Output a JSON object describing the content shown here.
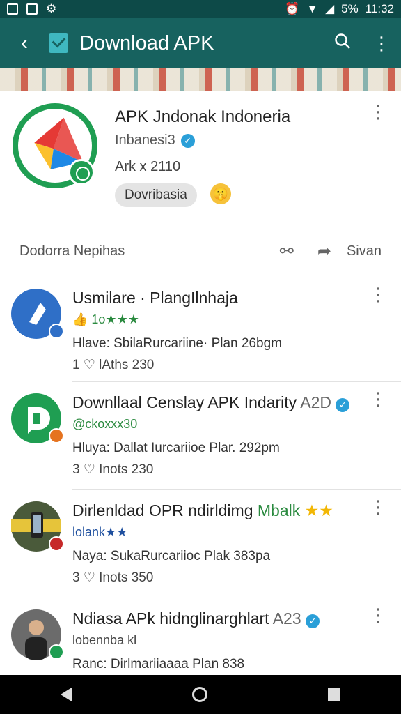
{
  "status_bar": {
    "battery": "5%",
    "time": "11:32"
  },
  "app_bar": {
    "back_icon": "arrow-left-icon",
    "title": "Download APK",
    "search_icon": "search-icon",
    "more_icon": "more-vert-icon"
  },
  "header": {
    "title": "APK Jndonak Indoneria",
    "subtitle": "Inbanesi3",
    "meta": "Ark x 2110",
    "chip": "Dovribasia",
    "footer_label": "Dodorra Nepihas",
    "share_label": "Sivan"
  },
  "feed": [
    {
      "title": "Usmilare · PlangIlnhaja",
      "rating": "👍 1o★★★",
      "info": "Hlave: SbilaRurcariine· Plan 26bgm",
      "stats": "1  ♡ lAths 230",
      "avatar_color": "#2f6fc7",
      "badge_color": "#2f6fc7"
    },
    {
      "title": "Downllaal Censlay APK Indarity",
      "title_suffix": "A2D",
      "rating": "@ckoxxx30",
      "info": "Hluya: Dallat Iurcariioe  Plar. 292pm",
      "stats": "3  ♡ Inots 230",
      "avatar_color": "#1f9e52",
      "badge_color": "#e5731f"
    },
    {
      "title": "Dirlenldad OPR ndirldimg",
      "title_highlight": "Mbalk",
      "rating": "lolank★★",
      "info": "Naya: SukaRurcariioc  Plak 383pa",
      "stats": "3  ♡ Inots 350",
      "avatar_color": "#4a5a3a",
      "badge_color": "#c62828"
    },
    {
      "title": "Ndiasa APk hidnglinarghlart",
      "title_suffix": "A23",
      "rating": "lobennba kl",
      "info": "Ranc: Dirlmariiaaaa  Plan 838",
      "stats": "",
      "avatar_color": "#6b6b6b",
      "badge_color": "#1f9e52"
    }
  ]
}
